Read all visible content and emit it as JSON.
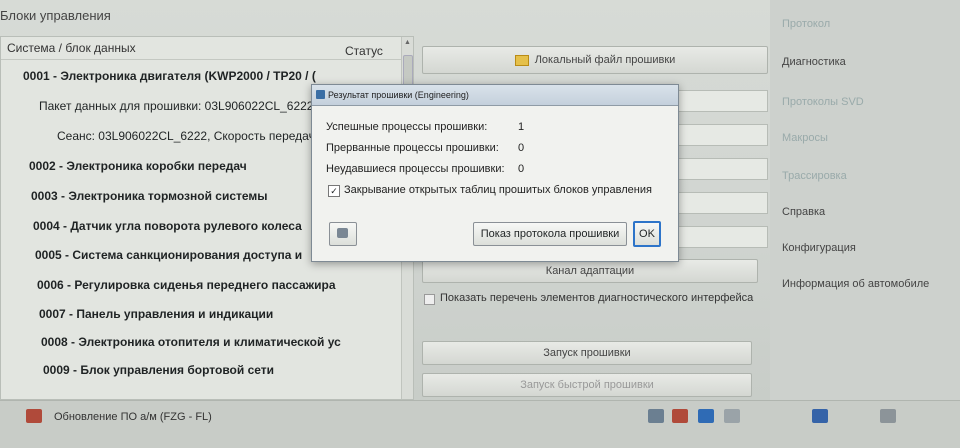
{
  "app": {
    "title": "Блоки управления"
  },
  "left": {
    "header": {
      "system": "Система / блок данных",
      "status": "Статус"
    },
    "rows": [
      "0001 - Электроника двигателя  (KWP2000 / TP20 / (",
      "Пакет данных для прошивки: 03L906022CL_6222",
      "Сеанс: 03L906022CL_6222, Скорость передач",
      "0002 - Электроника коробки передач",
      "0003 - Электроника тормозной системы",
      "0004 - Датчик угла поворота рулевого колеса",
      "0005 - Система санкционирования доступа и",
      "0006 - Регулировка сиденья переднего пассажира",
      "0007 - Панель управления и индикации",
      "0008 - Электроника отопителя и климатической ус",
      "0009 - Блок управления бортовой сети"
    ]
  },
  "center": {
    "local_file_button": "Локальный файл прошивки",
    "adaptation_channel_button": "Канал адаптации",
    "show_list_checkbox": "Показать перечень элементов диагностического интерфейса",
    "start_flash_button": "Запуск прошивки",
    "start_fast_flash_button": "Запуск быстрой прошивки"
  },
  "nav": {
    "items": [
      "Протокол",
      "Диагностика",
      "Протоколы SVD",
      "Макросы",
      "Трассировка",
      "Справка",
      "Конфигурация",
      "Информация об автомобиле"
    ]
  },
  "status_bar": {
    "text": "Обновление ПО а/м (FZG - FL)"
  },
  "dialog": {
    "title": "Результат прошивки (Engineering)",
    "lines": [
      {
        "label": "Успешные процессы прошивки:",
        "value": "1"
      },
      {
        "label": "Прерванные процессы прошивки:",
        "value": "0"
      },
      {
        "label": "Неудавшиеся процессы прошивки:",
        "value": "0"
      }
    ],
    "checkbox_label": "Закрывание открытых таблиц прошитых блоков управления",
    "show_protocol_button": "Показ протокола прошивки",
    "ok_button": "OK"
  }
}
